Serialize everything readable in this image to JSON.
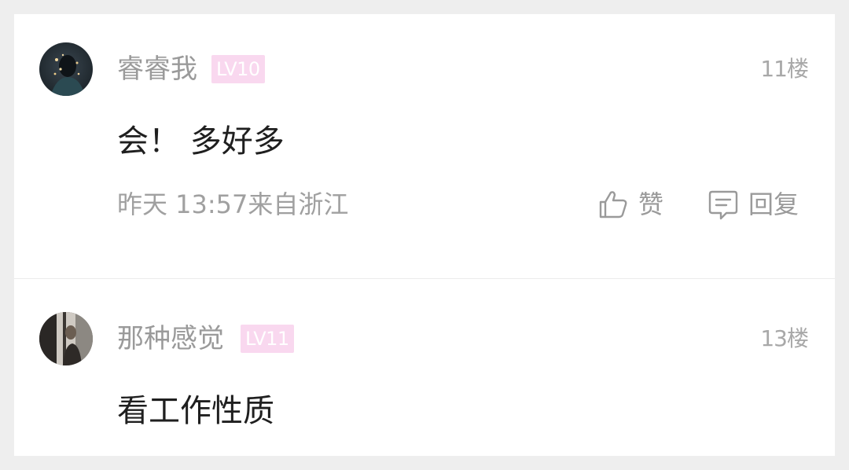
{
  "comments": [
    {
      "username": "睿睿我",
      "level": "LV10",
      "floor": "11楼",
      "content": "会！ 多好多",
      "meta": "昨天 13:57来自浙江",
      "like_label": "赞",
      "reply_label": "回复"
    },
    {
      "username": "那种感觉",
      "level": "LV11",
      "floor": "13楼",
      "content": "看工作性质"
    }
  ],
  "colors": {
    "level_badge_bg": "#f9d8ef",
    "secondary_text": "#9a9a9a",
    "primary_text": "#1f1f1f"
  }
}
